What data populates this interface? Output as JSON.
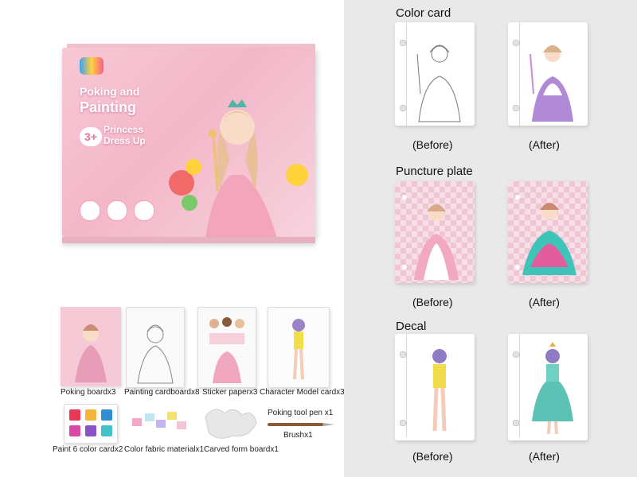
{
  "box": {
    "title_line1": "Poking and",
    "title_line2": "Painting",
    "age": "3+",
    "sub_line1": "Princess",
    "sub_line2": "Dress Up"
  },
  "contents": [
    {
      "caption": "Poking boardx3"
    },
    {
      "caption": "Painting cardboardx8"
    },
    {
      "caption": "Sticker paperx3"
    },
    {
      "caption": "Character Model cardx3"
    },
    {
      "caption": "Paint 6 color cardx2"
    },
    {
      "caption": "Color fabric materialx1"
    },
    {
      "caption": "Carved form boardx1"
    },
    {
      "caption": "Poking tool pen x1"
    },
    {
      "caption": "Brushx1"
    }
  ],
  "paint_colors": [
    "#e83a55",
    "#f3b63a",
    "#2f8fd0",
    "#d94aa7",
    "#8a54c7",
    "#43c2c9"
  ],
  "sections": [
    {
      "title": "Color card",
      "before": "(Before)",
      "after": "(After)"
    },
    {
      "title": "Puncture plate",
      "before": "(Before)",
      "after": "(After)"
    },
    {
      "title": "Decal",
      "before": "(Before)",
      "after": "(After)"
    }
  ]
}
